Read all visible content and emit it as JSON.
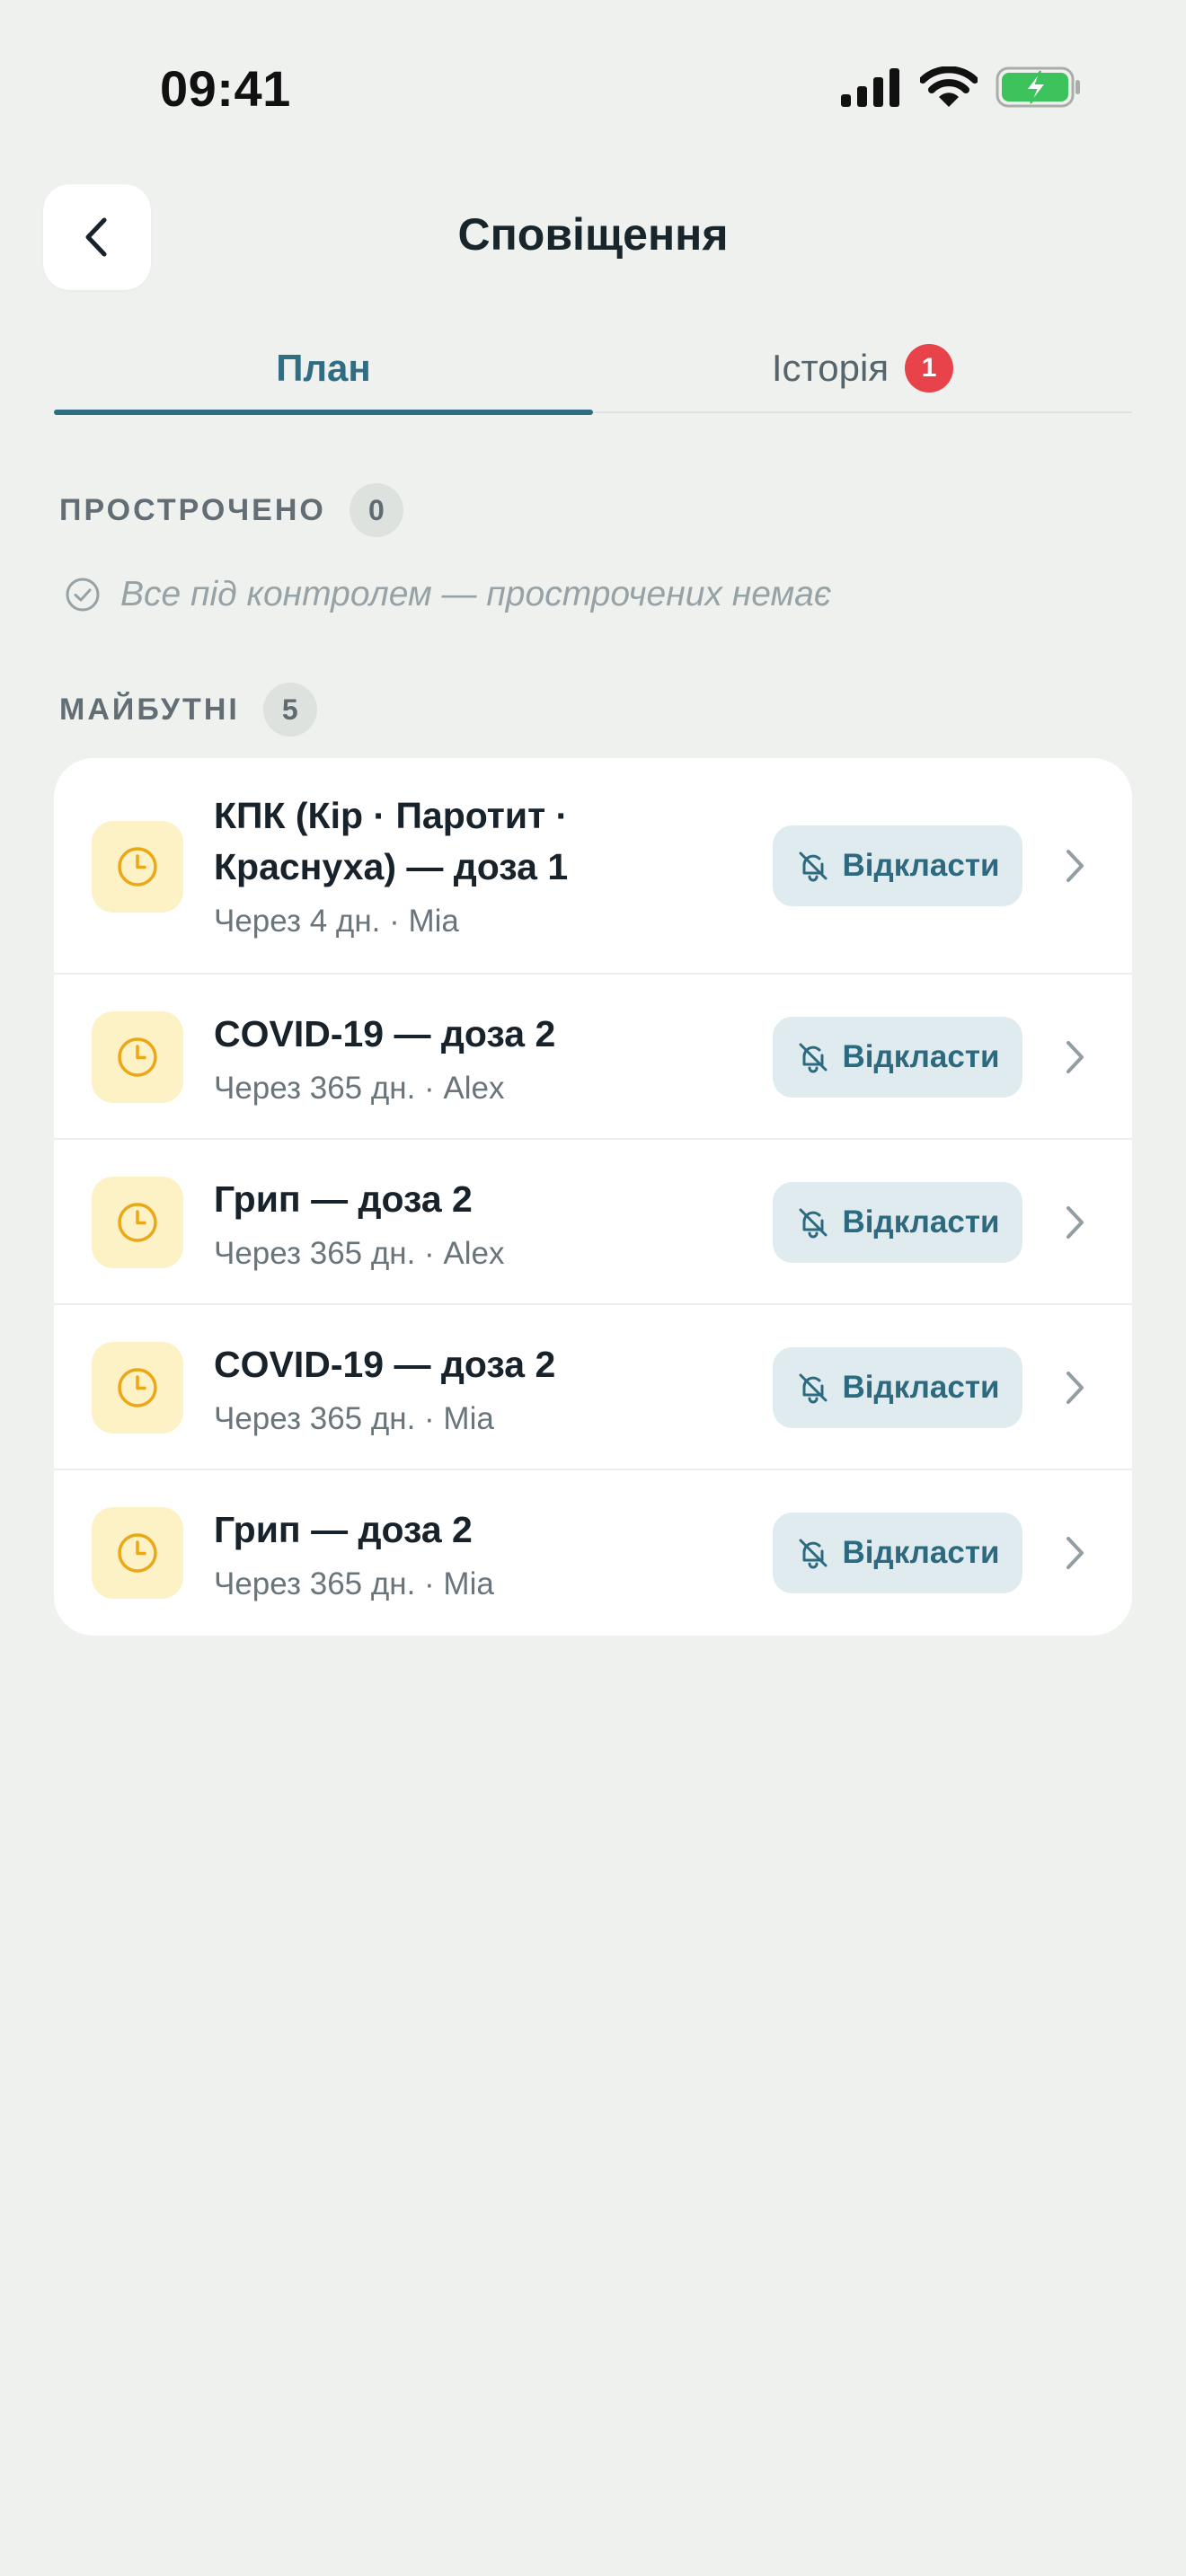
{
  "status_bar": {
    "time": "09:41",
    "icons": [
      "signal-icon",
      "wifi-icon",
      "battery-charging-icon"
    ],
    "battery_color": "#3cc35b"
  },
  "header": {
    "back_icon": "chevron-left-icon",
    "title": "Сповіщення"
  },
  "tabs": [
    {
      "label": "План",
      "active": true
    },
    {
      "label": "Історія",
      "badge": "1"
    }
  ],
  "overdue": {
    "title": "ПРОСТРОЧЕНО",
    "count": "0",
    "empty_text": "Все під контролем — прострочених немає"
  },
  "upcoming": {
    "title": "МАЙБУТНІ",
    "count": "5",
    "items": [
      {
        "title": "КПК (Кір · Паротит · Краснуха) — доза 1",
        "subtitle": "Через 4 дн. · Mia",
        "action": "Відкласти"
      },
      {
        "title": "COVID-19 — доза 2",
        "subtitle": "Через 365 дн. · Alex",
        "action": "Відкласти"
      },
      {
        "title": "Грип — доза 2",
        "subtitle": "Через 365 дн. · Alex",
        "action": "Відкласти"
      },
      {
        "title": "COVID-19 — доза 2",
        "subtitle": "Через 365 дн. · Mia",
        "action": "Відкласти"
      },
      {
        "title": "Грип — доза 2",
        "subtitle": "Через 365 дн. · Mia",
        "action": "Відкласти"
      }
    ]
  },
  "colors": {
    "accent": "#2f6d84",
    "badge_red": "#e8424a",
    "clock_icon": "#eaa817",
    "background": "#eff1ee"
  }
}
